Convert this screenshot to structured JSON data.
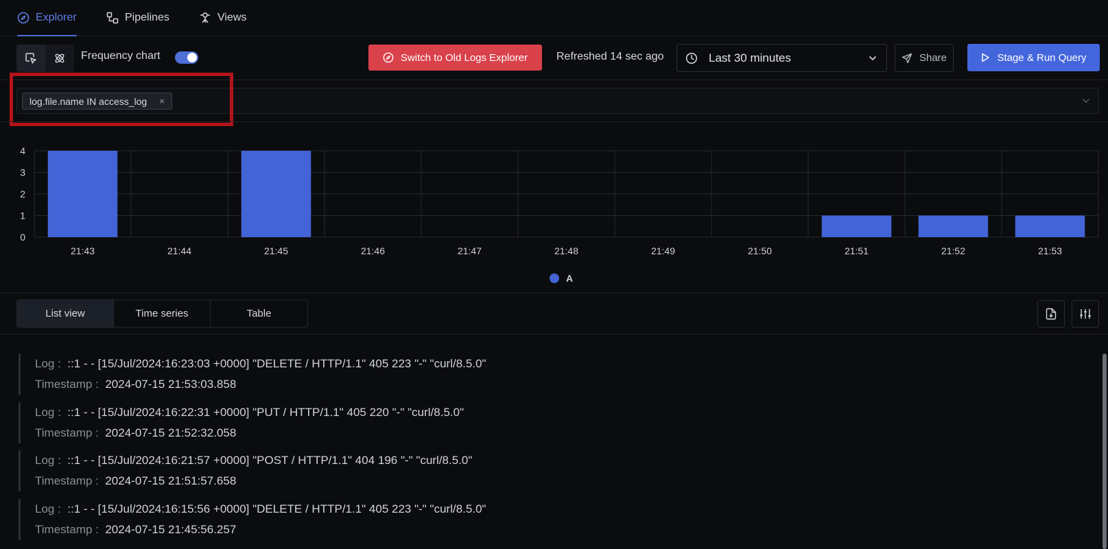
{
  "nav": {
    "tabs": [
      {
        "label": "Explorer",
        "icon": "compass-icon",
        "active": true
      },
      {
        "label": "Pipelines",
        "icon": "pipelines-icon",
        "active": false
      },
      {
        "label": "Views",
        "icon": "views-icon",
        "active": false
      }
    ]
  },
  "toolbar": {
    "frequency_chart_label": "Frequency chart",
    "frequency_chart_enabled": true,
    "switch_old_label": "Switch to Old Logs Explorer",
    "refreshed_label": "Refreshed 14 sec ago",
    "time_range": "Last 30 minutes",
    "share_label": "Share",
    "run_label": "Stage & Run Query"
  },
  "filter": {
    "chip_label": "log.file.name IN access_log",
    "remove_symbol": "×"
  },
  "chart_data": {
    "type": "bar",
    "categories": [
      "21:43",
      "21:44",
      "21:45",
      "21:46",
      "21:47",
      "21:48",
      "21:49",
      "21:50",
      "21:51",
      "21:52",
      "21:53"
    ],
    "series": [
      {
        "name": "A",
        "values": [
          4,
          0,
          4,
          0,
          0,
          0,
          0,
          0,
          1,
          1,
          1
        ]
      }
    ],
    "yticks": [
      0,
      1,
      2,
      3,
      4
    ],
    "ylim": [
      0,
      4
    ],
    "grid": true,
    "legend": "bottom-center",
    "color": "#4364d6"
  },
  "views": {
    "tabs": [
      {
        "label": "List view",
        "active": true
      },
      {
        "label": "Time series",
        "active": false
      },
      {
        "label": "Table",
        "active": false
      }
    ]
  },
  "logs": {
    "log_label": "Log :",
    "timestamp_label": "Timestamp :",
    "items": [
      {
        "log": "::1 - - [15/Jul/2024:16:23:03 +0000] \"DELETE / HTTP/1.1\" 405 223 \"-\" \"curl/8.5.0\"",
        "timestamp": "2024-07-15 21:53:03.858"
      },
      {
        "log": "::1 - - [15/Jul/2024:16:22:31 +0000] \"PUT / HTTP/1.1\" 405 220 \"-\" \"curl/8.5.0\"",
        "timestamp": "2024-07-15 21:52:32.058"
      },
      {
        "log": "::1 - - [15/Jul/2024:16:21:57 +0000] \"POST / HTTP/1.1\" 404 196 \"-\" \"curl/8.5.0\"",
        "timestamp": "2024-07-15 21:51:57.658"
      },
      {
        "log": "::1 - - [15/Jul/2024:16:15:56 +0000] \"DELETE / HTTP/1.1\" 405 223 \"-\" \"curl/8.5.0\"",
        "timestamp": "2024-07-15 21:45:56.257"
      }
    ]
  },
  "colors": {
    "accent": "#4e6fd6",
    "danger_button": "#d9414b",
    "primary_button": "#4466dc",
    "highlight_box": "#b3141b"
  }
}
